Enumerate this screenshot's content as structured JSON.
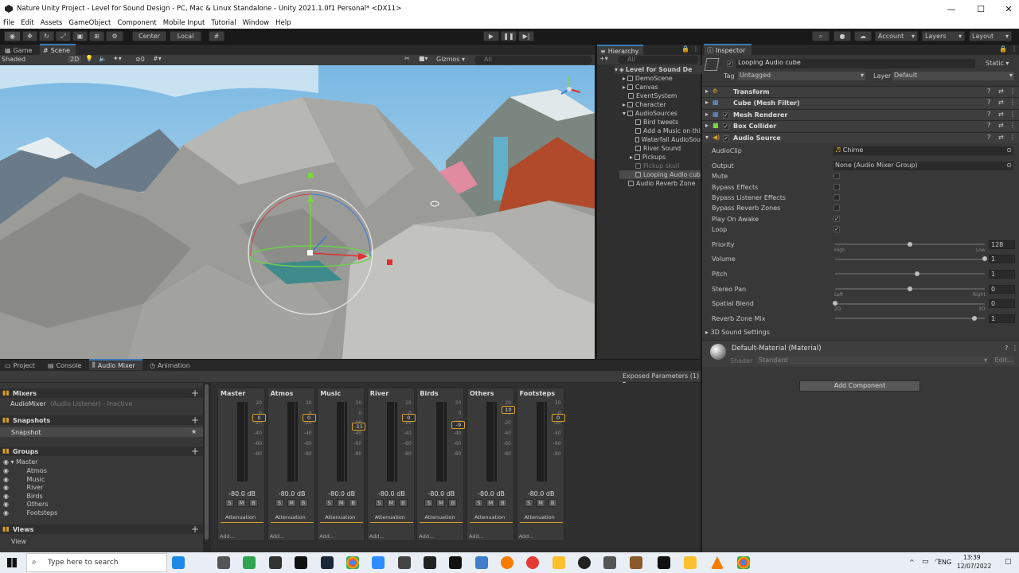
{
  "window": {
    "title": "Nature Unity Project - Level for Sound Design - PC, Mac & Linux Standalone - Unity 2021.1.0f1 Personal* <DX11>"
  },
  "menu": [
    "File",
    "Edit",
    "Assets",
    "GameObject",
    "Component",
    "Mobile Input",
    "Tutorial",
    "Window",
    "Help"
  ],
  "toolbar": {
    "center_label": "Center",
    "local_label": "Local",
    "account_label": "Account",
    "layers_label": "Layers",
    "layout_label": "Layout"
  },
  "scene_tabs": {
    "game": "Game",
    "scene": "Scene"
  },
  "scene_bar": {
    "shading": "Shaded",
    "mode2d": "2D",
    "fx_count": "0",
    "gizmos": "Gizmos",
    "search_placeholder": "All"
  },
  "hierarchy": {
    "tab": "Hierarchy",
    "search_placeholder": "All",
    "items": [
      {
        "label": "Level for Sound De"
      },
      {
        "label": "DemoScene"
      },
      {
        "label": "Canvas"
      },
      {
        "label": "EventSystem"
      },
      {
        "label": "Character"
      },
      {
        "label": "AudioSources"
      },
      {
        "label": "Bird tweets"
      },
      {
        "label": "Add a Music on thi"
      },
      {
        "label": "Waterfall AudioSou"
      },
      {
        "label": "River Sound"
      },
      {
        "label": "Pickups"
      },
      {
        "label": "Pickup skull"
      },
      {
        "label": "Looping Audio cub"
      },
      {
        "label": "Audio Reverb Zone"
      }
    ]
  },
  "inspector": {
    "tab": "Inspector",
    "object_name": "Looping Audio cube",
    "static_label": "Static",
    "tag_label": "Tag",
    "tag_value": "Untagged",
    "layer_label": "Layer",
    "layer_value": "Default",
    "components": [
      "Transform",
      "Cube (Mesh Filter)",
      "Mesh Renderer",
      "Box Collider",
      "Audio Source"
    ],
    "audio_source": {
      "audioclip_label": "AudioClip",
      "audioclip_value": "Chime",
      "output_label": "Output",
      "output_value": "None (Audio Mixer Group)",
      "mute_label": "Mute",
      "bypass_effects_label": "Bypass Effects",
      "bypass_listener_label": "Bypass Listener Effects",
      "bypass_reverb_label": "Bypass Reverb Zones",
      "play_on_awake_label": "Play On Awake",
      "loop_label": "Loop",
      "priority_label": "Priority",
      "priority_value": "128",
      "priority_low_hint": "High",
      "priority_high_hint": "Low",
      "volume_label": "Volume",
      "volume_value": "1",
      "pitch_label": "Pitch",
      "pitch_value": "1",
      "stereo_pan_label": "Stereo Pan",
      "stereo_pan_value": "0",
      "stereo_left_hint": "Left",
      "stereo_right_hint": "Right",
      "spatial_blend_label": "Spatial Blend",
      "spatial_blend_value": "0",
      "spatial_2d_hint": "2D",
      "spatial_3d_hint": "3D",
      "reverb_mix_label": "Reverb Zone Mix",
      "reverb_mix_value": "1",
      "sound3d_label": "3D Sound Settings",
      "mute": false,
      "bypass_effects": false,
      "bypass_listener": false,
      "bypass_reverb": false,
      "play_on_awake": true,
      "loop": true,
      "priority_fraction": 0.5,
      "volume_fraction": 1.0,
      "pitch_fraction": 0.55,
      "pan_fraction": 0.5,
      "blend_fraction": 0.0,
      "reverb_fraction": 0.93
    },
    "material_name": "Default-Material (Material)",
    "shader_label": "Shader",
    "shader_value": "Standard",
    "edit_label": "Edit...",
    "add_component_label": "Add Component"
  },
  "bottom_tabs": [
    "Project",
    "Console",
    "Audio Mixer",
    "Animation"
  ],
  "mixer": {
    "exposed_params": "Exposed Parameters (1)",
    "mixers_label": "Mixers",
    "mixer_item": "AudioMixer",
    "mixer_item_note": "(Audio Listener) - Inactive",
    "snapshots_label": "Snapshots",
    "snapshot_item": "Snapshot",
    "groups_label": "Groups",
    "groups": [
      "Master",
      "Atmos",
      "Music",
      "River",
      "Birds",
      "Others",
      "Footsteps"
    ],
    "views_label": "Views",
    "view_item": "View",
    "scale": [
      "20",
      "0",
      "-20",
      "-40",
      "-60",
      "-80"
    ],
    "strips": [
      {
        "name": "Master",
        "value": "0",
        "db": "-80.0 dB"
      },
      {
        "name": "Atmos",
        "value": "0",
        "db": "-80.0 dB"
      },
      {
        "name": "Music",
        "value": "-11",
        "db": "-80.0 dB"
      },
      {
        "name": "River",
        "value": "0",
        "db": "-80.0 dB"
      },
      {
        "name": "Birds",
        "value": "-9",
        "db": "-80.0 dB"
      },
      {
        "name": "Others",
        "value": "10",
        "db": "-80.0 dB"
      },
      {
        "name": "Footsteps",
        "value": "0",
        "db": "-80.0 dB"
      }
    ],
    "s_label": "S",
    "m_label": "M",
    "b_label": "B",
    "attenuation_label": "Attenuation",
    "add_label": "Add..."
  },
  "taskbar": {
    "search_placeholder": "Type here to search",
    "lang": "ENG",
    "time": "13:39",
    "date": "12/07/2022"
  }
}
